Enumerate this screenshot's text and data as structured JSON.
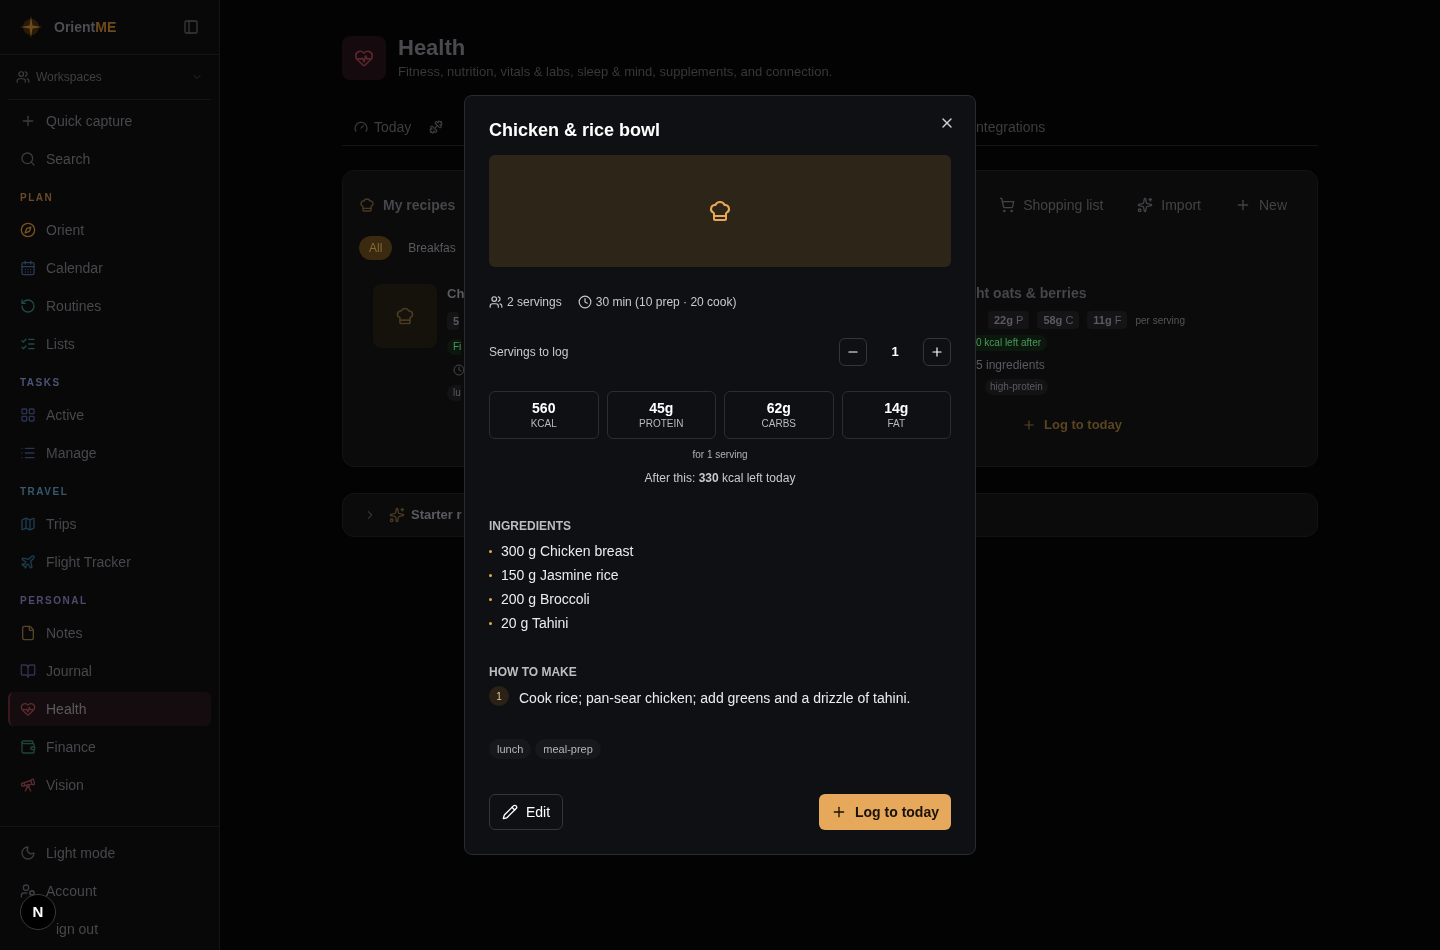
{
  "sidebar": {
    "brand": {
      "name": "Orient",
      "accent": "ME"
    },
    "workspaces": "Workspaces",
    "actions": [
      {
        "label": "Quick capture"
      },
      {
        "label": "Search"
      }
    ],
    "sections": [
      {
        "title": "PLAN",
        "color": "#6a4a2a",
        "items": [
          {
            "label": "Orient",
            "selected": false,
            "color": "#7a5222"
          },
          {
            "label": "Calendar",
            "selected": false,
            "color": "#2a3a55"
          },
          {
            "label": "Routines",
            "selected": false,
            "color": "#1f4a47"
          },
          {
            "label": "Lists",
            "selected": false,
            "color": "#1f4a47"
          }
        ]
      },
      {
        "title": "TASKS",
        "color": "#4c5478",
        "items": [
          {
            "label": "Active",
            "selected": false,
            "color": "#2a3350"
          },
          {
            "label": "Manage",
            "selected": false,
            "color": "#2a3350"
          }
        ]
      },
      {
        "title": "TRAVEL",
        "color": "#37596e",
        "items": [
          {
            "label": "Trips",
            "selected": false,
            "color": "#1e3d4e"
          },
          {
            "label": "Flight Tracker",
            "selected": false,
            "color": "#1e3d4e"
          }
        ]
      },
      {
        "title": "PERSONAL",
        "color": "#4e4a6e",
        "items": [
          {
            "label": "Notes",
            "selected": false,
            "color": "#5a4224"
          },
          {
            "label": "Journal",
            "selected": false,
            "color": "#33304d"
          },
          {
            "label": "Health",
            "selected": true,
            "color": "#5e2a30"
          },
          {
            "label": "Finance",
            "selected": false,
            "color": "#1f4636"
          },
          {
            "label": "Vision",
            "selected": false,
            "color": "#5a2a30"
          }
        ]
      }
    ],
    "footer": [
      {
        "label": "Light mode"
      },
      {
        "label": "Account"
      },
      {
        "label": "ign out"
      }
    ],
    "avatar": "N"
  },
  "header": {
    "title": "Health",
    "subtitle": "Fitness, nutrition, vitals & labs, sleep & mind, supplements, and connection."
  },
  "tabs": [
    {
      "label": "Today"
    },
    {
      "label": "ntegrations"
    }
  ],
  "recipes": {
    "title": "My recipes",
    "actions": [
      "Shopping list",
      "Import",
      "New"
    ],
    "filters": [
      {
        "label": "All",
        "selected": true
      },
      {
        "label": "Breakfas",
        "selected": false
      }
    ],
    "left_card": {
      "title": "Ch",
      "chip": "5",
      "badge": "Fi",
      "tag": "lu"
    },
    "right_card": {
      "title": "ht oats & berries",
      "macros": [
        "**22g** P",
        "**58g** C",
        "**11g** F"
      ],
      "per_serving": "per serving",
      "kcal_badge": "0 kcal left after",
      "ingredients": "5 ingredients",
      "tag": "high-protein",
      "log": "Log to today"
    }
  },
  "starter": {
    "title": "Starter r",
    "expanded": false
  },
  "modal": {
    "title": "Chicken & rice bowl",
    "servings": "2 servings",
    "time": "30 min (10 prep · 20 cook)",
    "servings_label": "Servings to log",
    "servings_value": "1",
    "macros": [
      {
        "value": "560",
        "label": "KCAL"
      },
      {
        "value": "45g",
        "label": "PROTEIN"
      },
      {
        "value": "62g",
        "label": "CARBS"
      },
      {
        "value": "14g",
        "label": "FAT"
      }
    ],
    "macros_note": "for 1 serving",
    "after": "After this: **330** kcal left today",
    "ingredients_title": "INGREDIENTS",
    "ingredients": [
      "300 g Chicken breast",
      "150 g Jasmine rice",
      "200 g Broccoli",
      "20 g Tahini"
    ],
    "steps_title": "HOW TO MAKE",
    "steps": [
      {
        "number": "1",
        "text": "Cook rice; pan-sear chicken; add greens and a drizzle of tahini."
      }
    ],
    "tags": [
      "lunch",
      "meal-prep"
    ],
    "edit": "Edit",
    "log": "Log to today"
  }
}
